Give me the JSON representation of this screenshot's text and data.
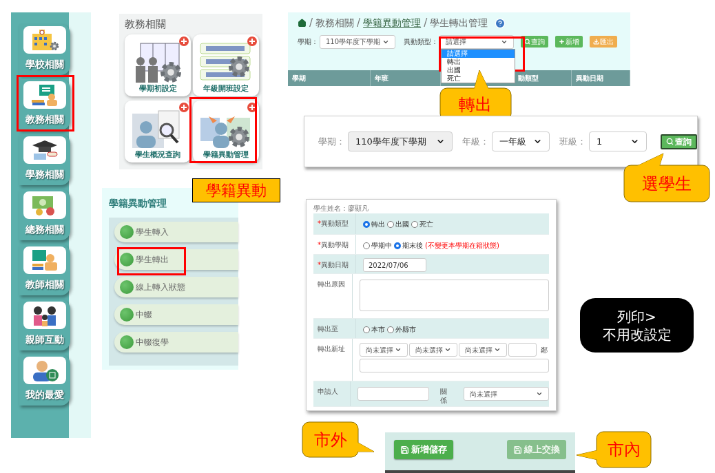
{
  "sidebar": {
    "items": [
      {
        "label": "學校相關",
        "highlighted": false
      },
      {
        "label": "教務相關",
        "highlighted": true
      },
      {
        "label": "學務相關",
        "highlighted": false
      },
      {
        "label": "總務相關",
        "highlighted": false
      },
      {
        "label": "教師相關",
        "highlighted": false
      },
      {
        "label": "親師互動",
        "highlighted": false
      },
      {
        "label": "我的最愛",
        "highlighted": false
      }
    ]
  },
  "tile_panel": {
    "title": "教務相關",
    "tiles": [
      {
        "label": "學期初設定",
        "highlighted": false
      },
      {
        "label": "年級開班設定",
        "highlighted": false
      },
      {
        "label": "學生概況查詢",
        "highlighted": false
      },
      {
        "label": "學籍異動管理",
        "highlighted": true
      }
    ],
    "note": "學籍異動"
  },
  "menu_panel": {
    "title": "學籍異動管理",
    "items": [
      {
        "label": "學生轉入",
        "highlighted": false
      },
      {
        "label": "學生轉出",
        "highlighted": true
      },
      {
        "label": "線上轉入狀態",
        "highlighted": false
      },
      {
        "label": "中輟",
        "highlighted": false
      },
      {
        "label": "中輟復學",
        "highlighted": false
      }
    ]
  },
  "transfer_page": {
    "breadcrumb": [
      {
        "kind": "sep",
        "text": "/"
      },
      {
        "kind": "text",
        "text": "教務相關"
      },
      {
        "kind": "sep",
        "text": "/"
      },
      {
        "kind": "link",
        "text": "學籍異動管理"
      },
      {
        "kind": "sep",
        "text": "/"
      },
      {
        "kind": "text",
        "text": "學生轉出管理"
      }
    ],
    "filters": [
      {
        "label": "學期：",
        "value": "110學年度下學期"
      },
      {
        "label": "異動類型：",
        "value": "請選擇"
      }
    ],
    "buttons": [
      {
        "label": "查詢",
        "kind": "search"
      },
      {
        "label": "新增",
        "kind": "add"
      },
      {
        "label": "匯出",
        "kind": "export"
      }
    ],
    "dropdown": {
      "highlighted": true,
      "options": [
        {
          "label": "請選擇",
          "selected": true
        },
        {
          "label": "轉出",
          "selected": false
        },
        {
          "label": "出國",
          "selected": false
        },
        {
          "label": "死亡",
          "selected": false
        }
      ]
    },
    "table": {
      "columns": [
        "學期",
        "年班",
        "動類型",
        "異動日期"
      ]
    },
    "callout": "轉出"
  },
  "query_panel": {
    "fields": [
      {
        "label": "學期：",
        "value": "110學年度下學期",
        "disabled": true
      },
      {
        "label": "年級：",
        "value": "一年級",
        "disabled": false
      },
      {
        "label": "班級：",
        "value": "1",
        "disabled": false
      }
    ],
    "button": "查詢",
    "callout": "選學生"
  },
  "form": {
    "student": "學生姓名：廖顯凡",
    "rows": [
      {
        "kind": "radio",
        "label": "異動類型",
        "mark": "*",
        "options": [
          {
            "label": "轉出",
            "selected": true
          },
          {
            "label": "出國",
            "selected": false
          },
          {
            "label": "死亡",
            "selected": false
          }
        ]
      },
      {
        "kind": "radio",
        "label": "異動學期",
        "mark": "*",
        "options": [
          {
            "label": "學期中",
            "selected": false
          },
          {
            "label": "期末後",
            "selected": true
          }
        ],
        "note": "(不變更本學期在籍狀態)"
      },
      {
        "kind": "date",
        "label": "異動日期",
        "mark": "*",
        "value": "2022/07/06"
      },
      {
        "kind": "textarea",
        "label": "轉出原因"
      },
      {
        "kind": "radio",
        "label": "轉出至",
        "options": [
          {
            "label": "本市",
            "selected": false
          },
          {
            "label": "外縣市",
            "selected": false
          }
        ]
      },
      {
        "kind": "address",
        "label": "轉出新址",
        "selects": [
          "尚未選擇",
          "尚未選擇",
          "尚未選擇"
        ],
        "suffix": "鄰"
      },
      {
        "kind": "applicant",
        "label": "申請人",
        "relation": "關係",
        "select": "尚未選擇"
      }
    ]
  },
  "print_note": [
    "列印>",
    "不用改設定"
  ],
  "action_bar": {
    "buttons": [
      {
        "label": "新增儲存",
        "disabled": false
      },
      {
        "label": "線上交換",
        "disabled": true
      }
    ],
    "left_callout": "市外",
    "right_callout": "市內"
  }
}
